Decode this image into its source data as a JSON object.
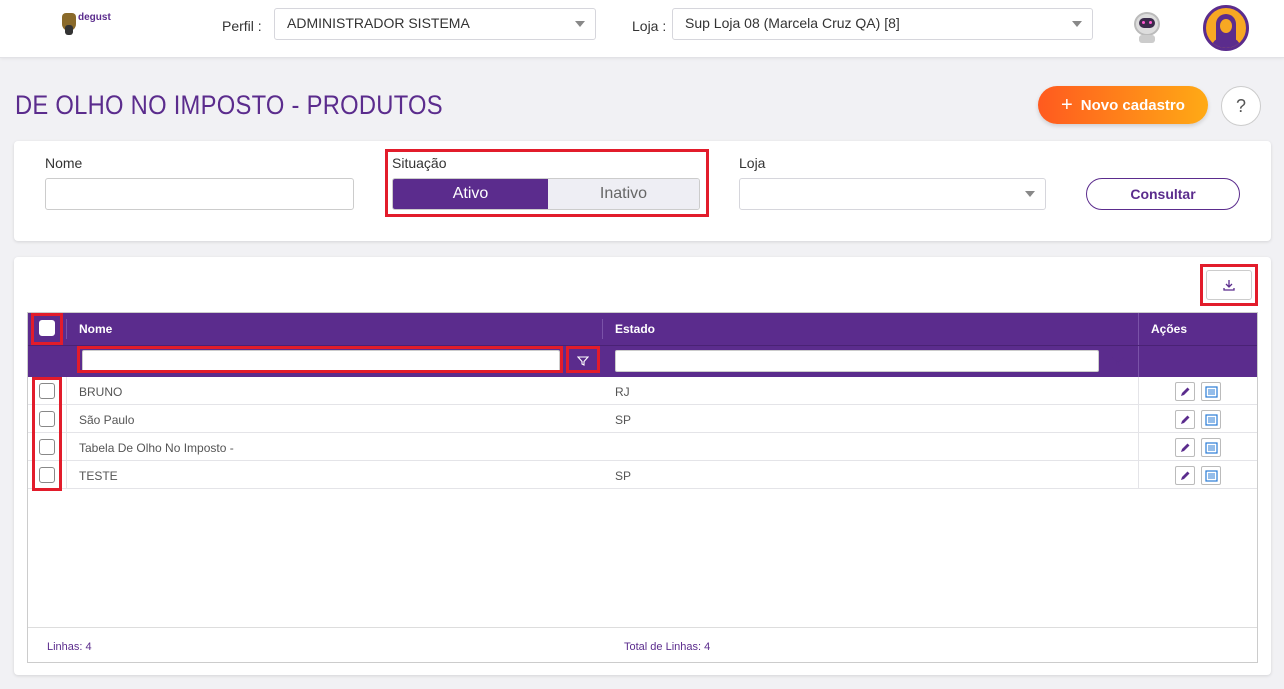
{
  "header": {
    "logo_text": "degust",
    "perfil_label": "Perfil :",
    "perfil_value": "ADMINISTRADOR SISTEMA",
    "loja_label": "Loja :",
    "loja_value": "Sup Loja 08 (Marcela Cruz QA) [8]"
  },
  "page": {
    "title": "DE OLHO NO IMPOSTO - PRODUTOS",
    "new_button": "Novo cadastro",
    "help_button": "?"
  },
  "filters": {
    "nome_label": "Nome",
    "nome_value": "",
    "situacao_label": "Situação",
    "situacao_options": [
      "Ativo",
      "Inativo"
    ],
    "situacao_selected": "Ativo",
    "loja_label": "Loja",
    "loja_value": "",
    "consultar_button": "Consultar"
  },
  "grid": {
    "columns": [
      "Nome",
      "Estado",
      "Ações"
    ],
    "rows": [
      {
        "nome": "BRUNO",
        "estado": "RJ"
      },
      {
        "nome": "São Paulo",
        "estado": "SP"
      },
      {
        "nome": "Tabela De Olho No Imposto -",
        "estado": ""
      },
      {
        "nome": "TESTE",
        "estado": "SP"
      }
    ],
    "footer_lines": "Linhas: 4",
    "footer_total": "Total de Linhas: 4"
  },
  "colors": {
    "primary": "#5b2c8d",
    "accent_start": "#ff5a1f",
    "accent_end": "#ffaa15",
    "highlight": "#e21c2b"
  }
}
